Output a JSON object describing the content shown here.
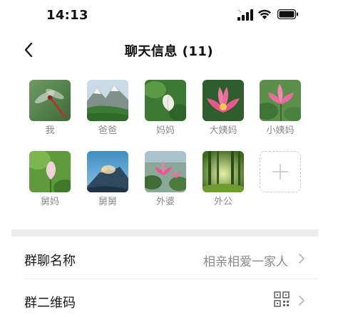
{
  "status_bar": {
    "time": "14:13"
  },
  "nav": {
    "title": "聊天信息 (11)"
  },
  "members": [
    {
      "name": "我",
      "image": "dragonfly"
    },
    {
      "name": "爸爸",
      "image": "mountain-valley"
    },
    {
      "name": "妈妈",
      "image": "lotus-bud-white"
    },
    {
      "name": "大姨妈",
      "image": "pink-lotus"
    },
    {
      "name": "小姨妈",
      "image": "pink-lotus-leaves"
    },
    {
      "name": "舅妈",
      "image": "lotus-bud-green"
    },
    {
      "name": "舅舅",
      "image": "mountain-peak"
    },
    {
      "name": "外婆",
      "image": "lotus-pond"
    },
    {
      "name": "外公",
      "image": "forest"
    }
  ],
  "add_member": {
    "icon": "plus-icon"
  },
  "settings": {
    "group_name": {
      "label": "群聊名称",
      "value": "相亲相爱一家人"
    },
    "qr_code": {
      "label": "群二维码",
      "icon": "qr-code-icon"
    }
  }
}
